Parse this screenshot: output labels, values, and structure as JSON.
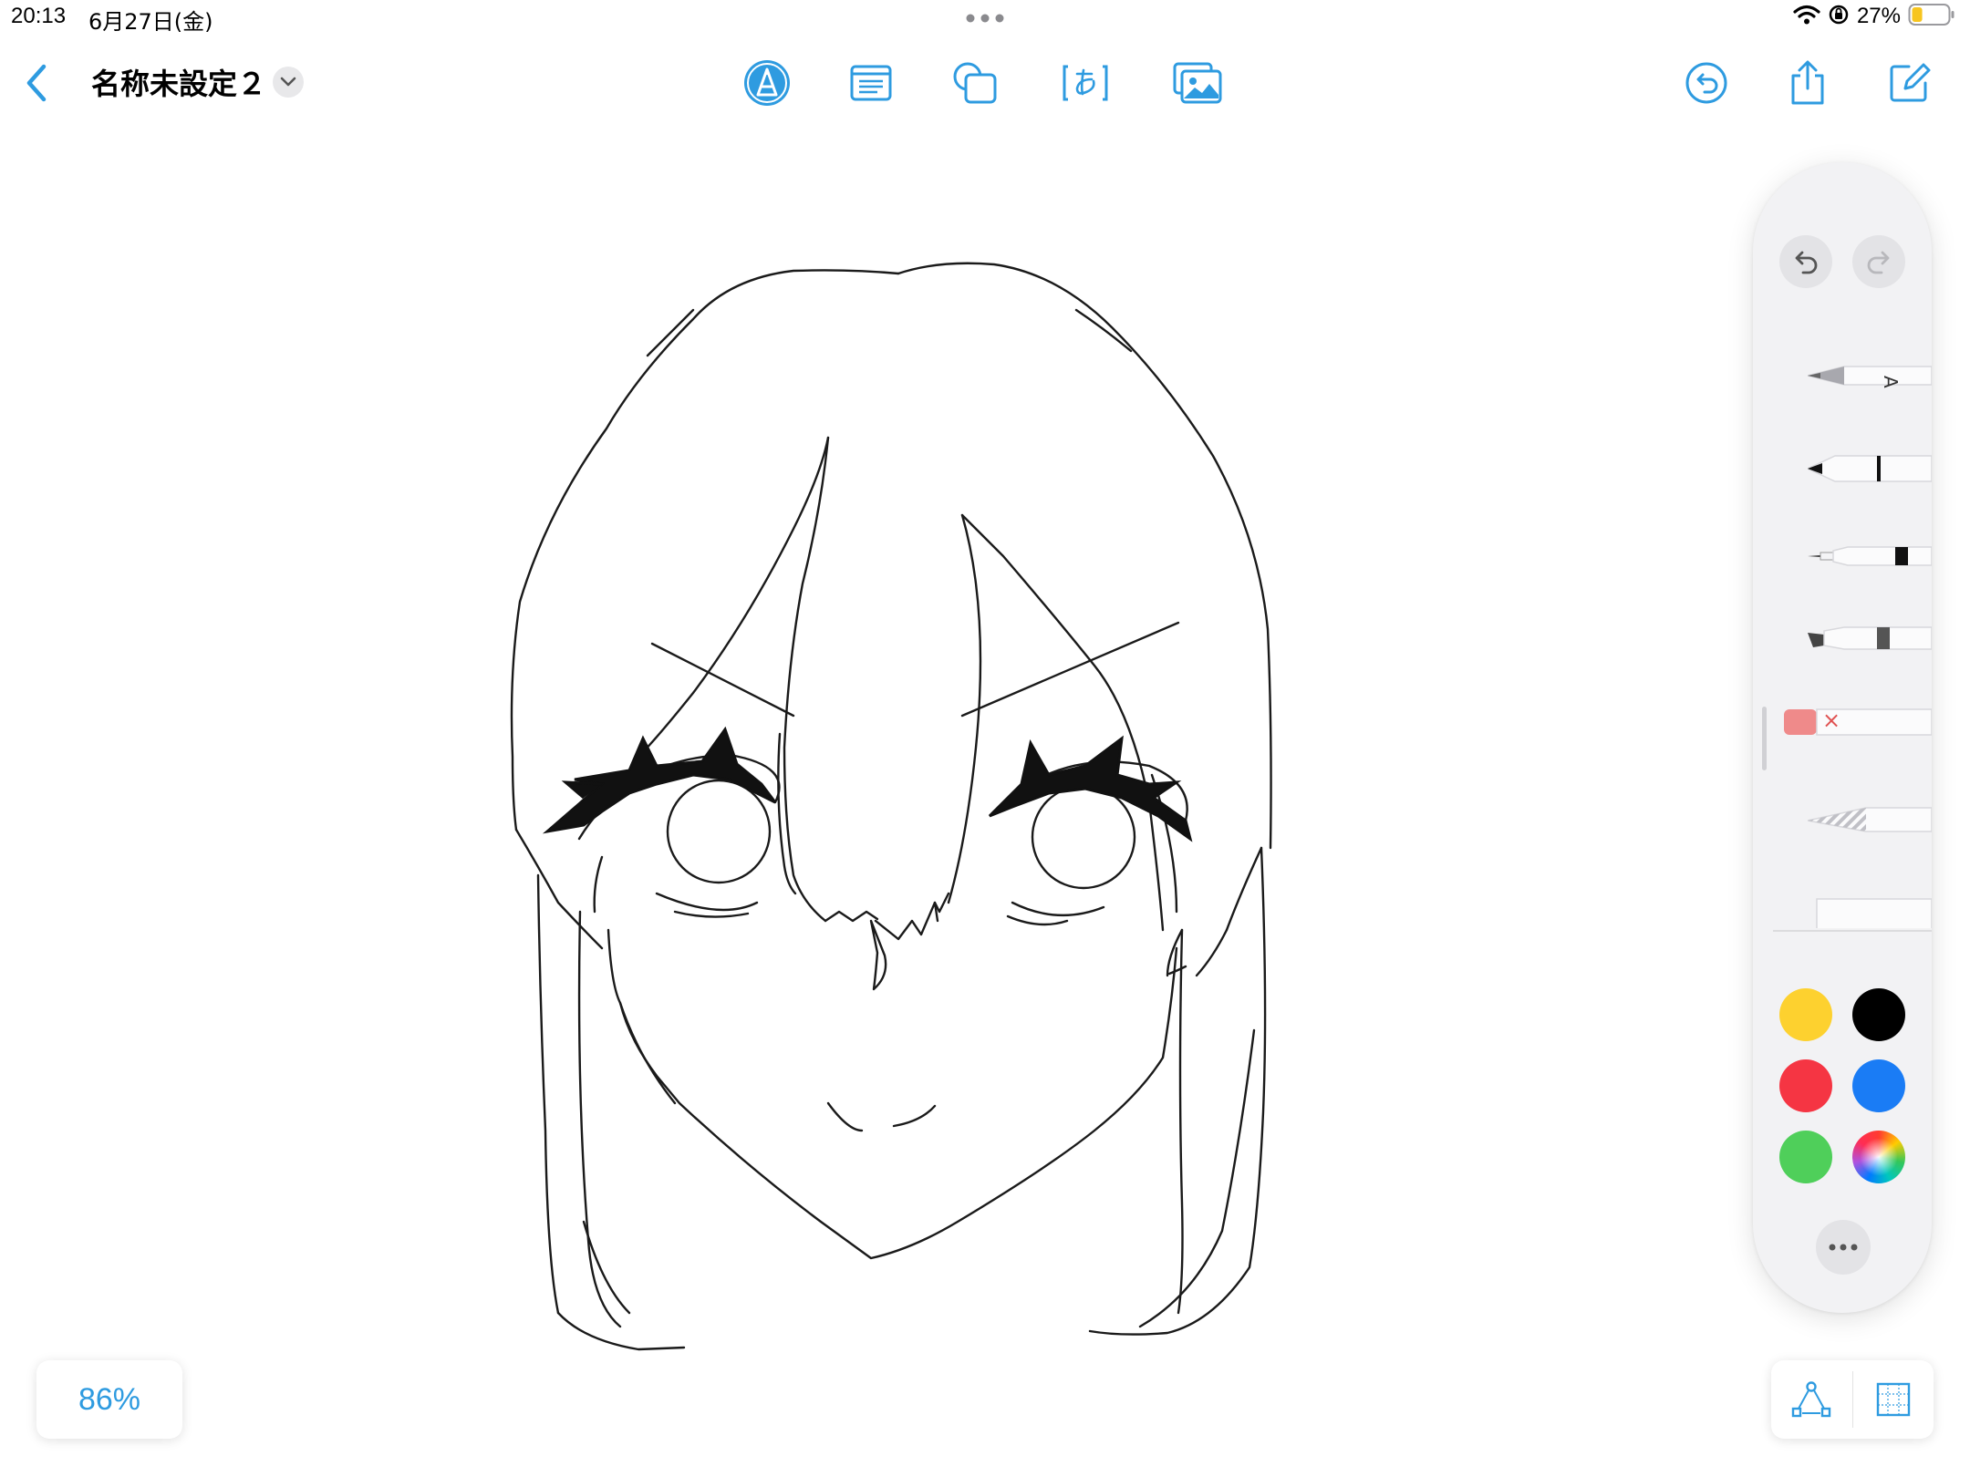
{
  "status_bar": {
    "time": "20:13",
    "date": "6月27日(金)",
    "battery_percent": "27%",
    "battery_level": 0.27
  },
  "toolbar": {
    "title": "名称未設定２"
  },
  "palette": {
    "colors": {
      "yellow": "#fdd12f",
      "black": "#000000",
      "red": "#f53543",
      "blue": "#1a7cf5",
      "green": "#4fcf5a"
    },
    "eraser_mark": "×"
  },
  "zoom": {
    "level": "86%"
  },
  "theme": {
    "accent": "#2e9be0"
  }
}
